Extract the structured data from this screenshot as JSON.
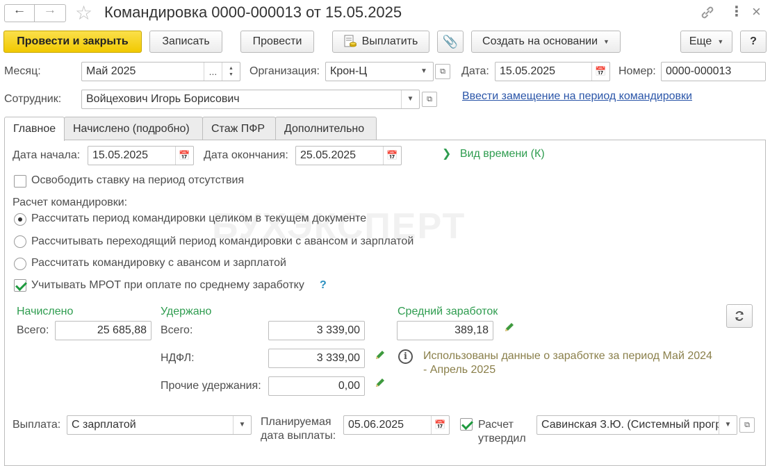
{
  "window": {
    "title": "Командировка 0000-000013 от 15.05.2025",
    "more_label": "Еще",
    "help_label": "?"
  },
  "toolbar": {
    "post_close": "Провести и закрыть",
    "save": "Записать",
    "post": "Провести",
    "pay": "Выплатить",
    "create_based": "Создать на основании"
  },
  "header": {
    "month_label": "Месяц:",
    "month_value": "Май 2025",
    "org_label": "Организация:",
    "org_value": "Крон-Ц",
    "date_label": "Дата:",
    "date_value": "15.05.2025",
    "number_label": "Номер:",
    "number_value": "0000-000013",
    "employee_label": "Сотрудник:",
    "employee_value": "Войцехович Игорь Борисович",
    "replacement_link": "Ввести замещение на период командировки",
    "dots": "..."
  },
  "tabs": [
    {
      "label": "Главное"
    },
    {
      "label": "Начислено (подробно)"
    },
    {
      "label": "Стаж ПФР"
    },
    {
      "label": "Дополнительно"
    }
  ],
  "main": {
    "start_label": "Дата начала:",
    "start_value": "15.05.2025",
    "end_label": "Дата окончания:",
    "end_value": "25.05.2025",
    "time_type": "Вид времени (К)",
    "free_rate": "Освободить ставку на период отсутствия",
    "calc_label": "Расчет командировки:",
    "radio1": "Рассчитать период командировки целиком в текущем документе",
    "radio2": "Рассчитывать переходящий период командировки с авансом и зарплатой",
    "radio3": "Рассчитать командировку с авансом и зарплатой",
    "mrot": "Учитывать МРОТ при оплате по среднему заработку",
    "mrot_help": "?",
    "accrued_title": "Начислено",
    "accrued_total_label": "Всего:",
    "accrued_total": "25 685,88",
    "withheld_title": "Удержано",
    "withheld_total_label": "Всего:",
    "withheld_total": "3 339,00",
    "ndfl_label": "НДФЛ:",
    "ndfl_value": "3 339,00",
    "other_label": "Прочие удержания:",
    "other_value": "0,00",
    "avg_title": "Средний заработок",
    "avg_value": "389,18",
    "info_text": "Использованы данные о заработке за период Май 2024 - Апрель 2025",
    "payment_label": "Выплата:",
    "payment_value": "С зарплатой",
    "planned_label": "Планируемая дата выплаты:",
    "planned_value": "05.06.2025",
    "approved_label": "Расчет утвердил",
    "approved_value": "Савинская З.Ю. (Системный программист)"
  },
  "watermark": "БУХЭКСПЕРТ",
  "colors": {
    "primary_button": "#f5d21a",
    "green_heading": "#2e9c4f",
    "link": "#2a55a8",
    "info_text": "#8a7f4a"
  }
}
